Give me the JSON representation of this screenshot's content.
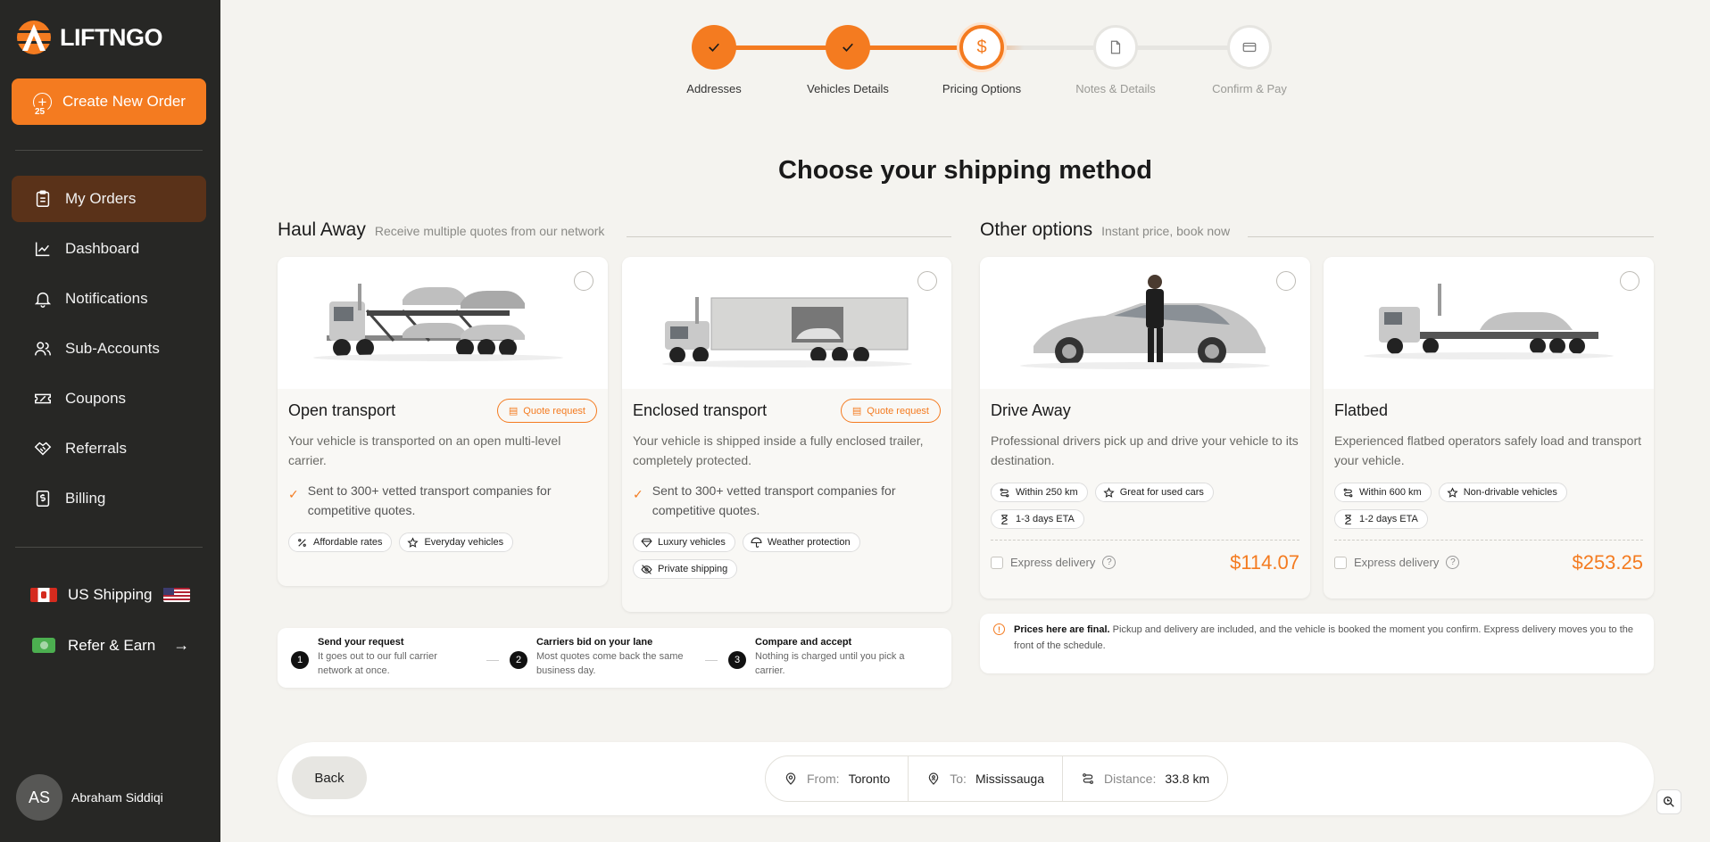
{
  "brand": {
    "name": "LIFTNGO",
    "accent": "#f47b20"
  },
  "sidebar": {
    "create_label": "Create New Order",
    "items": [
      {
        "label": "My Orders",
        "icon": "clipboard-icon",
        "active": true
      },
      {
        "label": "Dashboard",
        "icon": "chart-icon"
      },
      {
        "label": "Notifications",
        "icon": "bell-icon"
      },
      {
        "label": "Sub-Accounts",
        "icon": "users-icon"
      },
      {
        "label": "Coupons",
        "icon": "ticket-icon"
      },
      {
        "label": "Referrals",
        "icon": "handshake-icon"
      },
      {
        "label": "Billing",
        "icon": "dollar-doc-icon"
      }
    ],
    "notifications_badge": "25",
    "shipping_label": "US Shipping",
    "refer_label": "Refer & Earn",
    "user": {
      "initials": "AS",
      "name": "Abraham Siddiqi"
    }
  },
  "stepper": {
    "steps": [
      {
        "label": "Addresses",
        "state": "done"
      },
      {
        "label": "Vehicles Details",
        "state": "done"
      },
      {
        "label": "Pricing Options",
        "state": "current"
      },
      {
        "label": "Notes & Details",
        "state": "pending"
      },
      {
        "label": "Confirm & Pay",
        "state": "pending"
      }
    ]
  },
  "main": {
    "title": "Choose your shipping method",
    "haul": {
      "title": "Haul Away",
      "subtitle": "Receive multiple quotes from our network",
      "cards": [
        {
          "name": "Open transport",
          "tag": "Quote request",
          "desc": "Your vehicle is transported on an open multi-level carrier.",
          "check": "Sent to 300+ vetted transport companies for competitive quotes.",
          "chips": [
            "Affordable rates",
            "Everyday vehicles"
          ]
        },
        {
          "name": "Enclosed transport",
          "tag": "Quote request",
          "desc": "Your vehicle is shipped inside a fully enclosed trailer, completely protected.",
          "check": "Sent to 300+ vetted transport companies for competitive quotes.",
          "chips": [
            "Luxury vehicles",
            "Weather protection",
            "Private shipping"
          ]
        }
      ]
    },
    "other": {
      "title": "Other options",
      "subtitle": "Instant price, book now",
      "cards": [
        {
          "name": "Drive Away",
          "desc": "Professional drivers pick up and drive your vehicle to its destination.",
          "chips": [
            "Within 250 km",
            "Great for used cars",
            "1-3 days ETA"
          ],
          "express": "Express delivery",
          "price": "$114.07"
        },
        {
          "name": "Flatbed",
          "desc": "Experienced flatbed operators safely load and transport your vehicle.",
          "chips": [
            "Within 600 km",
            "Non-drivable vehicles",
            "1-2 days ETA"
          ],
          "express": "Express delivery",
          "price": "$253.25"
        }
      ]
    },
    "how": [
      {
        "num": "1",
        "title": "Send your request",
        "desc": "It goes out to our full carrier network at once."
      },
      {
        "num": "2",
        "title": "Carriers bid on your lane",
        "desc": "Most quotes come back the same business day."
      },
      {
        "num": "3",
        "title": "Compare and accept",
        "desc": "Nothing is charged until you pick a carrier."
      }
    ],
    "note": {
      "bold": "Prices here are final.",
      "text": " Pickup and delivery are included, and the vehicle is booked the moment you confirm. Express delivery moves you to the front of the schedule."
    }
  },
  "footer": {
    "back_label": "Back",
    "from_key": "From:",
    "from_val": "Toronto",
    "to_key": "To:",
    "to_val": "Mississauga",
    "dist_key": "Distance:",
    "dist_val": "33.8 km"
  }
}
